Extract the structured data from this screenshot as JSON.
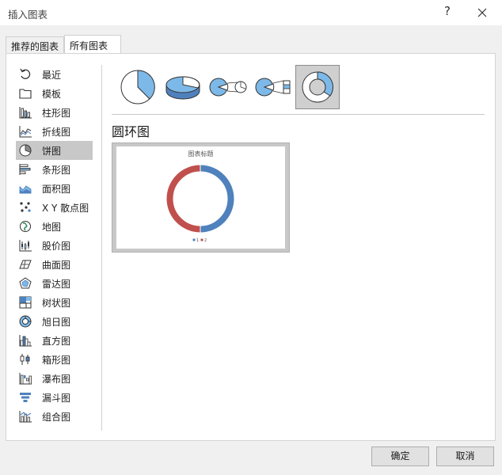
{
  "window": {
    "title": "插入图表",
    "help": "?"
  },
  "tabs": [
    {
      "label": "推荐的图表"
    },
    {
      "label": "所有图表",
      "active": true
    }
  ],
  "nav": {
    "items": [
      {
        "label": "最近",
        "icon": "recent-icon"
      },
      {
        "label": "模板",
        "icon": "folder-icon"
      },
      {
        "label": "柱形图",
        "icon": "column-chart-icon"
      },
      {
        "label": "折线图",
        "icon": "line-chart-icon"
      },
      {
        "label": "饼图",
        "icon": "pie-chart-icon",
        "selected": true
      },
      {
        "label": "条形图",
        "icon": "bar-chart-icon"
      },
      {
        "label": "面积图",
        "icon": "area-chart-icon"
      },
      {
        "label": "X Y 散点图",
        "icon": "scatter-chart-icon"
      },
      {
        "label": "地图",
        "icon": "map-chart-icon"
      },
      {
        "label": "股价图",
        "icon": "stock-chart-icon"
      },
      {
        "label": "曲面图",
        "icon": "surface-chart-icon"
      },
      {
        "label": "雷达图",
        "icon": "radar-chart-icon"
      },
      {
        "label": "树状图",
        "icon": "treemap-chart-icon"
      },
      {
        "label": "旭日图",
        "icon": "sunburst-chart-icon"
      },
      {
        "label": "直方图",
        "icon": "histogram-chart-icon"
      },
      {
        "label": "箱形图",
        "icon": "box-whisker-chart-icon"
      },
      {
        "label": "瀑布图",
        "icon": "waterfall-chart-icon"
      },
      {
        "label": "漏斗图",
        "icon": "funnel-chart-icon"
      },
      {
        "label": "组合图",
        "icon": "combo-chart-icon"
      }
    ]
  },
  "subtypes": [
    {
      "icon": "pie-icon"
    },
    {
      "icon": "3d-pie-icon"
    },
    {
      "icon": "pie-of-pie-icon"
    },
    {
      "icon": "bar-of-pie-icon"
    },
    {
      "icon": "doughnut-icon",
      "selected": true
    }
  ],
  "main": {
    "chart_name": "圆环图",
    "preview": {
      "title": "图表标题",
      "legend": [
        "1",
        "2"
      ]
    }
  },
  "chart_data": {
    "type": "pie",
    "title": "图表标题",
    "categories": [
      "1",
      "2"
    ],
    "values": [
      50,
      50
    ],
    "colors": [
      "#4f81bd",
      "#c0504d"
    ]
  },
  "colors": {
    "accent_blue": "#4f81bd",
    "accent_red": "#c0504d",
    "icon_blue": "#7db9e8",
    "selected_bg": "#c8c8c8"
  },
  "buttons": {
    "ok": "确定",
    "cancel": "取消"
  }
}
